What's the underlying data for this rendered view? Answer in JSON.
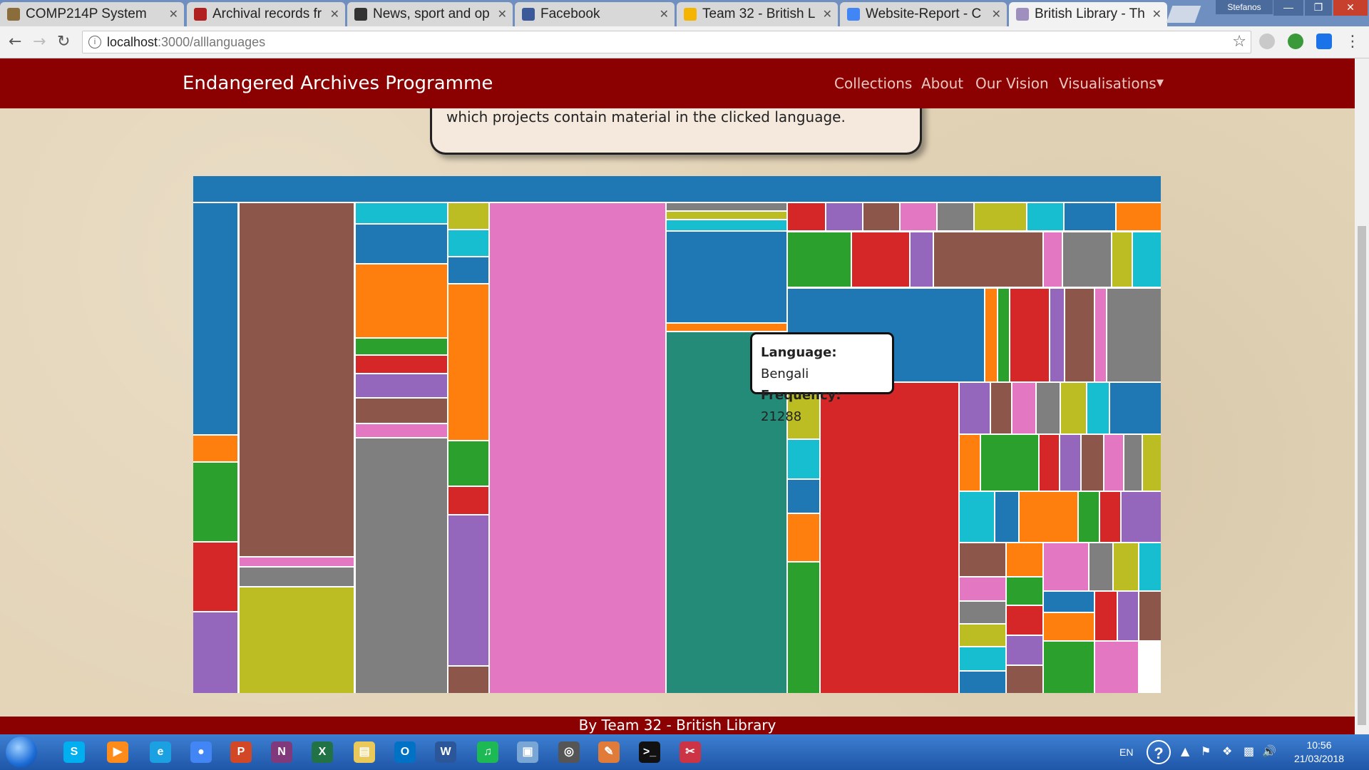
{
  "browser": {
    "tabs": [
      {
        "title": "COMP214P System",
        "favicon": "ucl-icon",
        "color": "#8a6d3b",
        "active": false
      },
      {
        "title": "Archival records fr",
        "favicon": "archive-icon",
        "color": "#b02020",
        "active": false
      },
      {
        "title": "News, sport and op",
        "favicon": "guardian-icon",
        "color": "#333333",
        "active": false
      },
      {
        "title": "Facebook",
        "favicon": "facebook-icon",
        "color": "#3b5998",
        "active": false
      },
      {
        "title": "Team 32 - British L",
        "favicon": "google-drive-icon",
        "color": "#f4b400",
        "active": false
      },
      {
        "title": "Website-Report - C",
        "favicon": "google-docs-icon",
        "color": "#4285f4",
        "active": false
      },
      {
        "title": "British Library - Th",
        "favicon": "page-icon",
        "color": "#9e8fbf",
        "active": true
      }
    ],
    "profile_name": "Stefanos",
    "url_host": "localhost",
    "url_path": ":3000/alllanguages"
  },
  "navbar": {
    "brand": "Endangered Archives Programme",
    "links": [
      "Collections",
      "About",
      "Our Vision",
      "Visualisations"
    ]
  },
  "info_text": "which projects contain material in the clicked language.",
  "tooltip": {
    "language_label": "Language:",
    "language_value": "Bengali",
    "frequency_label": "Frequency:",
    "frequency_value": "21288"
  },
  "palette": {
    "blue": "#1f77b4",
    "orange": "#ff7f0e",
    "green": "#2ca02c",
    "red": "#d62728",
    "purple": "#9467bd",
    "brown": "#8c564b",
    "pink": "#e377c2",
    "gray": "#7f7f7f",
    "olive": "#bcbd22",
    "cyan": "#17becf",
    "teal": "#238b77"
  },
  "footer": "By Team 32 - British Library",
  "taskbar": {
    "apps": [
      "skype",
      "media-player",
      "internet-explorer",
      "chrome",
      "powerpoint",
      "onenote",
      "excel",
      "file-explorer",
      "outlook",
      "word",
      "spotify",
      "remote-desktop",
      "headset",
      "paint",
      "terminal",
      "snipping-tool"
    ],
    "language": "EN",
    "time": "10:56",
    "date": "21/03/2018"
  }
}
